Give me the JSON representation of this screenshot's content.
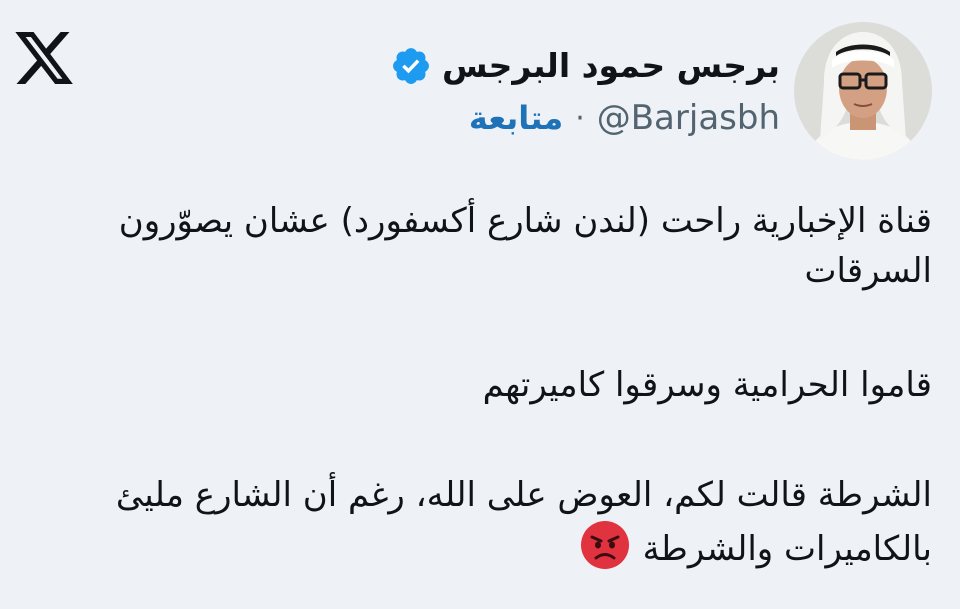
{
  "author": {
    "display_name": "برجس حمود البرجس",
    "handle": "@Barjasbh",
    "separator": "·",
    "follow_label": "متابعة",
    "verified": true,
    "avatar_icon": "person-avatar"
  },
  "brand": {
    "logo": "x-logo-icon"
  },
  "tweet": {
    "line1": "قناة الإخبارية راحت (لندن شارع أكسفورد) عشان يصوّرون السرقات",
    "line2": "قاموا الحرامية وسرقوا كاميرتهم",
    "line3": "الشرطة قالت لكم، العوض على الله، رغم أن الشارع مليئ بالكاميرات والشرطة",
    "emoji": "angry-face-emoji"
  },
  "colors": {
    "background": "#eef1f5",
    "text": "#0f1419",
    "secondary": "#536471",
    "follow": "#1d72b8",
    "verified": "#1d9bf0"
  }
}
